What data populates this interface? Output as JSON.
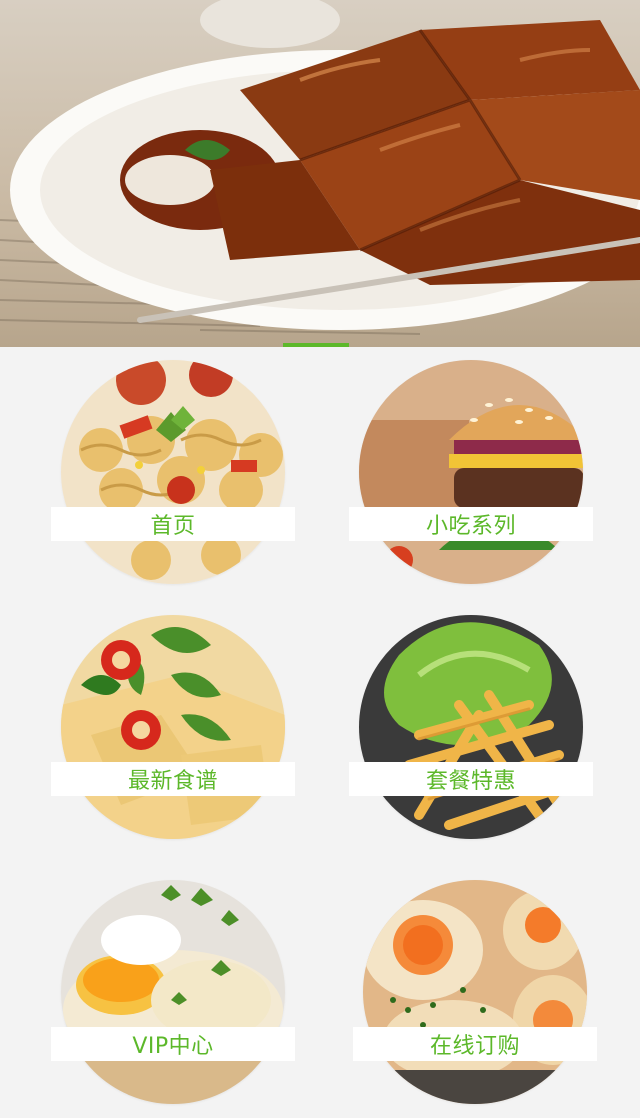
{
  "banner": {
    "image": "braised-duck-photo",
    "indicator_color": "#5cb82a"
  },
  "menu": {
    "accent_color": "#5cb82a",
    "items": [
      {
        "label": "首页",
        "image": "pasta-salad-photo"
      },
      {
        "label": "小吃系列",
        "image": "burger-photo"
      },
      {
        "label": "最新食谱",
        "image": "chicken-chili-photo"
      },
      {
        "label": "套餐特惠",
        "image": "fries-lettuce-photo"
      },
      {
        "label": "VIP中心",
        "image": "egg-toast-photo"
      },
      {
        "label": "在线订购",
        "image": "egg-tart-photo"
      }
    ]
  }
}
